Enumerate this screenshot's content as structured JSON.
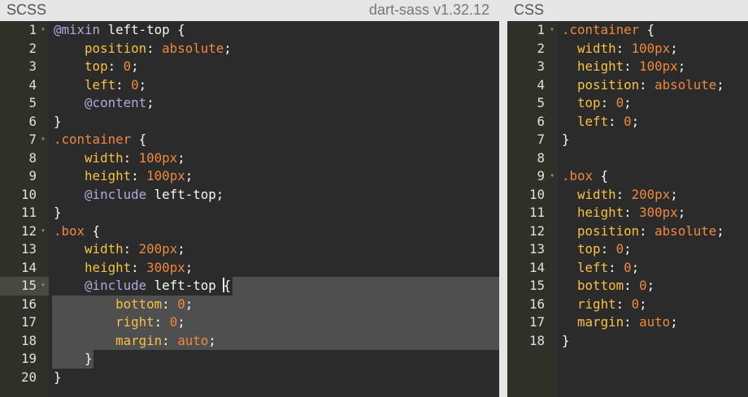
{
  "scss": {
    "title": "SCSS",
    "version": "dart-sass v1.32.12",
    "lines": [
      {
        "n": "1",
        "fold": true,
        "code": "@mixin left-top {"
      },
      {
        "n": "2",
        "fold": false,
        "code": "    position: absolute;"
      },
      {
        "n": "3",
        "fold": false,
        "code": "    top: 0;"
      },
      {
        "n": "4",
        "fold": false,
        "code": "    left: 0;"
      },
      {
        "n": "5",
        "fold": false,
        "code": "    @content;"
      },
      {
        "n": "6",
        "fold": false,
        "code": "}"
      },
      {
        "n": "7",
        "fold": true,
        "code": ".container {"
      },
      {
        "n": "8",
        "fold": false,
        "code": "    width: 100px;"
      },
      {
        "n": "9",
        "fold": false,
        "code": "    height: 100px;"
      },
      {
        "n": "10",
        "fold": false,
        "code": "    @include left-top;"
      },
      {
        "n": "11",
        "fold": false,
        "code": "}"
      },
      {
        "n": "12",
        "fold": true,
        "code": ".box {"
      },
      {
        "n": "13",
        "fold": false,
        "code": "    width: 200px;"
      },
      {
        "n": "14",
        "fold": false,
        "code": "    height: 300px;"
      },
      {
        "n": "15",
        "fold": true,
        "code": "    @include left-top {"
      },
      {
        "n": "16",
        "fold": false,
        "code": "        bottom: 0;"
      },
      {
        "n": "17",
        "fold": false,
        "code": "        right: 0;"
      },
      {
        "n": "18",
        "fold": false,
        "code": "        margin: auto;"
      },
      {
        "n": "19",
        "fold": false,
        "code": "    }"
      },
      {
        "n": "20",
        "fold": false,
        "code": "}"
      }
    ]
  },
  "css": {
    "title": "CSS",
    "lines": [
      {
        "n": "1",
        "fold": true,
        "code": ".container {"
      },
      {
        "n": "2",
        "fold": false,
        "code": "  width: 100px;"
      },
      {
        "n": "3",
        "fold": false,
        "code": "  height: 100px;"
      },
      {
        "n": "4",
        "fold": false,
        "code": "  position: absolute;"
      },
      {
        "n": "5",
        "fold": false,
        "code": "  top: 0;"
      },
      {
        "n": "6",
        "fold": false,
        "code": "  left: 0;"
      },
      {
        "n": "7",
        "fold": false,
        "code": "}"
      },
      {
        "n": "8",
        "fold": false,
        "code": ""
      },
      {
        "n": "9",
        "fold": true,
        "code": ".box {"
      },
      {
        "n": "10",
        "fold": false,
        "code": "  width: 200px;"
      },
      {
        "n": "11",
        "fold": false,
        "code": "  height: 300px;"
      },
      {
        "n": "12",
        "fold": false,
        "code": "  position: absolute;"
      },
      {
        "n": "13",
        "fold": false,
        "code": "  top: 0;"
      },
      {
        "n": "14",
        "fold": false,
        "code": "  left: 0;"
      },
      {
        "n": "15",
        "fold": false,
        "code": "  bottom: 0;"
      },
      {
        "n": "16",
        "fold": false,
        "code": "  right: 0;"
      },
      {
        "n": "17",
        "fold": false,
        "code": "  margin: auto;"
      },
      {
        "n": "18",
        "fold": false,
        "code": "}"
      }
    ]
  },
  "icons": {
    "fold": "fold-arrow-icon"
  },
  "colors": {
    "editor_bg": "#2b2b2b",
    "property": "#f7c244",
    "value": "#f0883e",
    "keyword": "#b0a9dd"
  }
}
